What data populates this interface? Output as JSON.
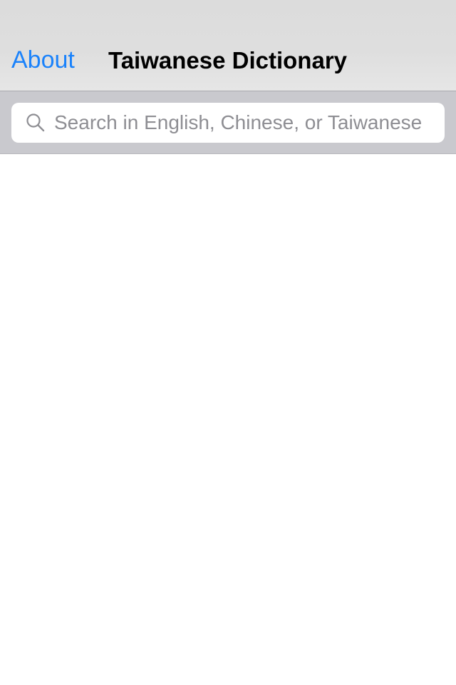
{
  "navbar": {
    "left_button_label": "About",
    "title": "Taiwanese Dictionary"
  },
  "search": {
    "placeholder": "Search in English, Chinese, or Taiwanese",
    "value": "",
    "icon": "search-icon"
  },
  "results": {
    "items": []
  },
  "colors": {
    "accent": "#1a82fb",
    "navbar_bg": "#dedede",
    "searchbar_bg": "#c9c9ce",
    "placeholder": "#8e8e93"
  }
}
